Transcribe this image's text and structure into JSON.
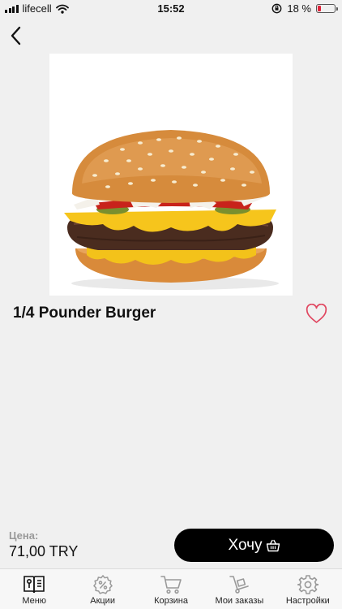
{
  "status_bar": {
    "carrier": "lifecell",
    "time": "15:52",
    "battery_text": "18 %"
  },
  "header": {
    "back_icon": "chevron-left-icon"
  },
  "product": {
    "image_icon": "burger-image",
    "title": "1/4 Pounder Burger",
    "favorite_icon": "heart-outline-icon",
    "favorite_color": "#e0455f"
  },
  "order_bar": {
    "price_label": "Цена:",
    "price_value": "71,00 TRY",
    "order_button_label": "Хочу",
    "order_button_icon": "basket-icon",
    "button_color": "#000000"
  },
  "tabs": [
    {
      "label": "Меню",
      "icon": "menu-book-icon",
      "active": true
    },
    {
      "label": "Акции",
      "icon": "discount-gear-icon",
      "active": false
    },
    {
      "label": "Корзина",
      "icon": "cart-icon",
      "active": false
    },
    {
      "label": "Мои заказы",
      "icon": "hand-truck-icon",
      "active": false
    },
    {
      "label": "Настройки",
      "icon": "gear-icon",
      "active": false
    }
  ]
}
